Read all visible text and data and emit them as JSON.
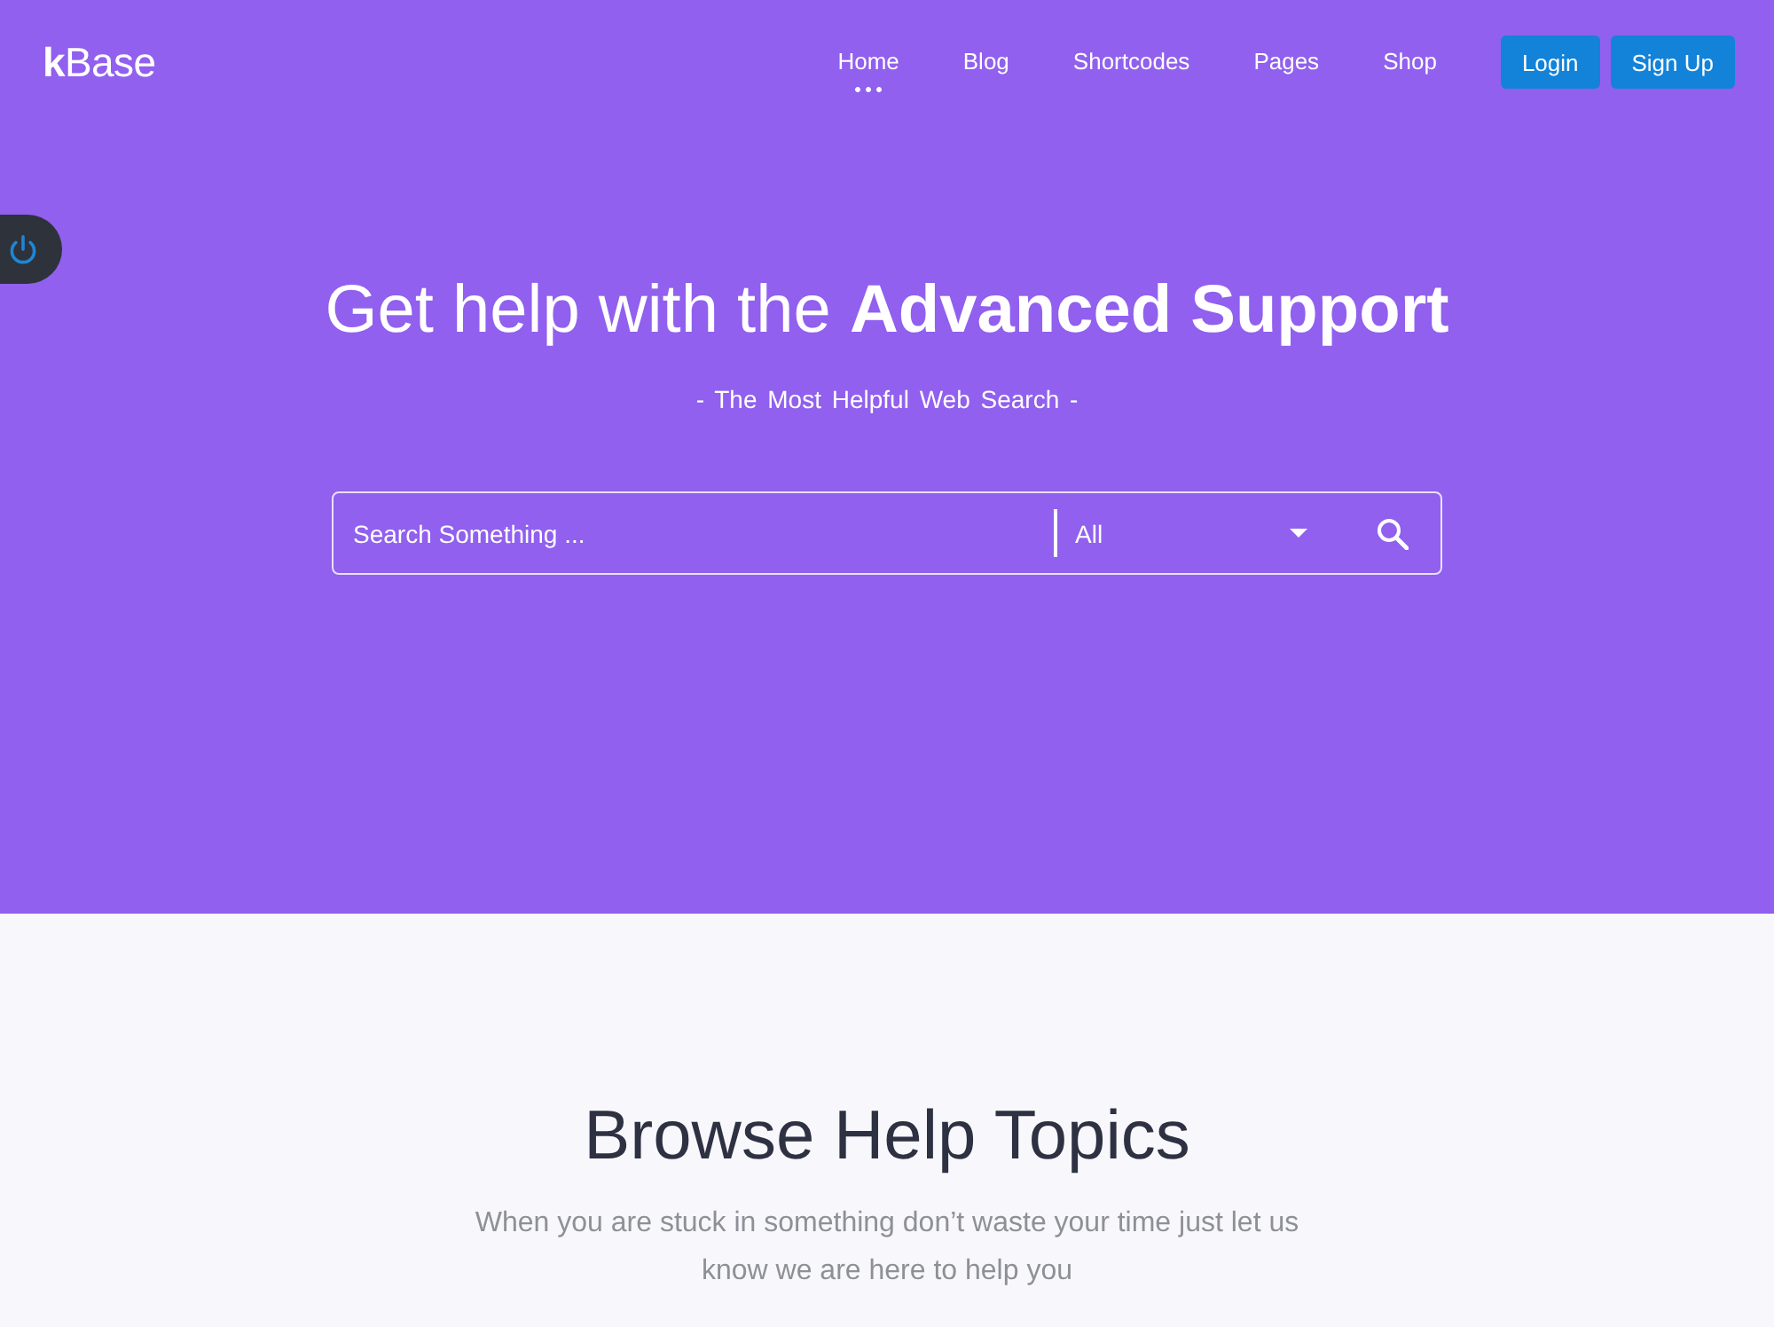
{
  "header": {
    "logo": "**k**Base",
    "nav": [
      {
        "label": "Home",
        "selected": true
      },
      {
        "label": "Blog",
        "selected": false
      },
      {
        "label": "Shortcodes",
        "selected": false
      },
      {
        "label": "Pages",
        "selected": false
      },
      {
        "label": "Shop",
        "selected": false
      }
    ],
    "buttons": [
      "Login",
      "Sign Up"
    ]
  },
  "hero": {
    "title": "Get help with the **Advanced Support**",
    "subtitle": "- The Most Helpful Web Search -",
    "search": {
      "placeholder": "Search Something ...",
      "category": "All"
    }
  },
  "topics": {
    "title": "Browse Help Topics",
    "description": "When you are stuck in something don’t waste your time just let us know we are here to help you"
  }
}
